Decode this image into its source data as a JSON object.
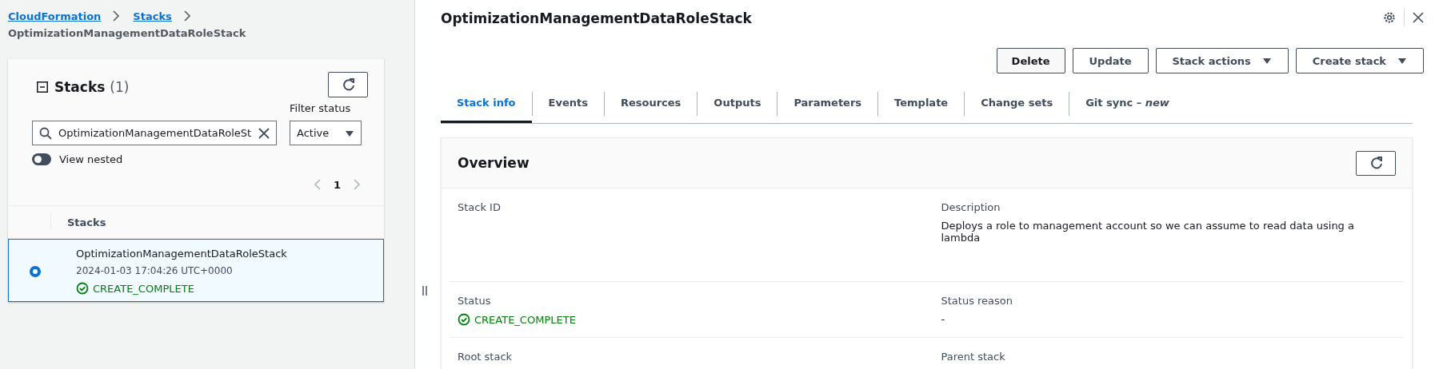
{
  "breadcrumb": {
    "links": [
      "CloudFormation",
      "Stacks"
    ],
    "current": "OptimizationManagementDataRoleStack"
  },
  "stacks_panel": {
    "title": "Stacks",
    "count": "(1)",
    "search": {
      "value": "OptimizationManagementDataRoleSt"
    },
    "filter": {
      "label": "Filter status",
      "value": "Active"
    },
    "view_nested": {
      "label": "View nested",
      "on": false
    },
    "pagination": {
      "page": "1"
    },
    "column": "Stacks",
    "rows": [
      {
        "name": "OptimizationManagementDataRoleStack",
        "time": "2024-01-03 17:04:26 UTC+0000",
        "status": "CREATE_COMPLETE",
        "selected": true
      }
    ]
  },
  "detail": {
    "title": "OptimizationManagementDataRoleStack",
    "buttons": [
      {
        "label": "Delete",
        "kind": "plain"
      },
      {
        "label": "Update",
        "kind": "plain"
      },
      {
        "label": "Stack actions",
        "kind": "dropdown"
      },
      {
        "label": "Create stack",
        "kind": "dropdown"
      }
    ],
    "tabs": [
      {
        "label": "Stack info",
        "selected": true
      },
      {
        "label": "Events",
        "selected": false
      },
      {
        "label": "Resources",
        "selected": false
      },
      {
        "label": "Outputs",
        "selected": false
      },
      {
        "label": "Parameters",
        "selected": false
      },
      {
        "label": "Template",
        "selected": false
      },
      {
        "label": "Change sets",
        "selected": false
      },
      {
        "label": "Git sync – *new*",
        "selected": false
      }
    ],
    "overview": {
      "title": "Overview",
      "rows": [
        [
          {
            "label": "Stack ID"
          },
          {
            "label": "Description",
            "value": "Deploys a role to management account so we can assume to read data using a lambda"
          }
        ],
        [
          {
            "label": "Status",
            "value": "CREATE_COMPLETE",
            "kind": "status"
          },
          {
            "label": "Status reason",
            "value": "-"
          }
        ],
        [
          {
            "label": "Root stack"
          },
          {
            "label": "Parent stack"
          }
        ]
      ]
    }
  }
}
